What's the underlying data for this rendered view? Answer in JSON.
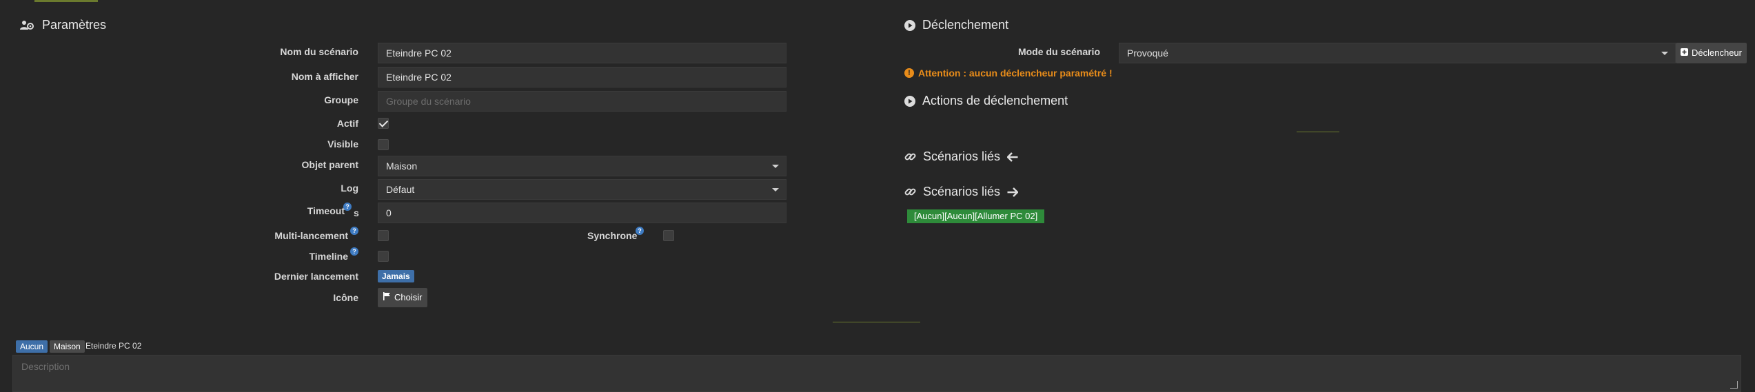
{
  "left": {
    "title": "Paramètres",
    "fields": {
      "name_label": "Nom du scénario",
      "name_value": "Eteindre PC 02",
      "display_label": "Nom à afficher",
      "display_value": "Eteindre PC 02",
      "group_label": "Groupe",
      "group_placeholder": "Groupe du scénario",
      "active_label": "Actif",
      "visible_label": "Visible",
      "parent_label": "Objet parent",
      "parent_value": "Maison",
      "log_label": "Log",
      "log_value": "Défaut",
      "timeout_label": "Timeout",
      "timeout_unit": "s",
      "timeout_value": "0",
      "multi_label": "Multi-lancement",
      "sync_label": "Synchrone",
      "timeline_label": "Timeline",
      "last_label": "Dernier lancement",
      "last_value": "Jamais",
      "icon_label": "Icône",
      "icon_button": "Choisir"
    },
    "checkboxes": {
      "active": true,
      "visible": false,
      "multi": false,
      "sync": false,
      "timeline": false
    },
    "help_glyph": "?"
  },
  "right": {
    "trigger_title": "Déclenchement",
    "mode_label": "Mode du scénario",
    "mode_value": "Provoqué",
    "add_trigger_button": "Déclencheur",
    "warning": "Attention : aucun déclencheur paramétré !",
    "actions_title": "Actions de déclenchement",
    "linked_in_title": "Scénarios liés",
    "linked_out_title": "Scénarios liés",
    "linked_tag": "[Aucun][Aucun][Allumer PC 02]"
  },
  "bottom": {
    "breadcrumb": [
      "Aucun",
      "Maison",
      "Eteindre PC 02"
    ],
    "description_placeholder": "Description"
  },
  "colors": {
    "background": "#262626",
    "input": "#333333",
    "accent_blue": "#3e6fa8",
    "warning": "#e88c1a",
    "green_tag": "#2e8b3a"
  }
}
